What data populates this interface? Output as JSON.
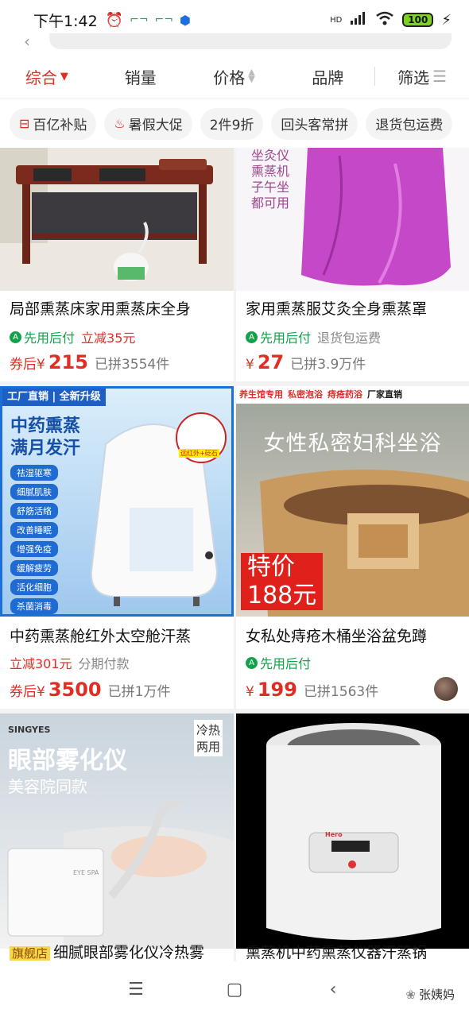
{
  "status": {
    "time": "下午1:42",
    "battery": "100",
    "hd": "HD"
  },
  "sort": {
    "items": [
      "综合",
      "销量",
      "价格",
      "品牌",
      "筛选"
    ]
  },
  "chips": [
    {
      "label": "百亿补贴"
    },
    {
      "label": "暑假大促"
    },
    {
      "label": "2件9折"
    },
    {
      "label": "回头客常拼"
    },
    {
      "label": "退货包运费"
    }
  ],
  "products": [
    {
      "title": "局部熏蒸床家用熏蒸床全身",
      "tag1": "先用后付",
      "tag2": "立减35元",
      "price_prefix": "券后¥",
      "price": "215",
      "sold": "已拼3554件",
      "image_text": []
    },
    {
      "title": "家用熏蒸服艾灸全身熏蒸罩",
      "tag1": "先用后付",
      "tag2": "退货包运费",
      "price_prefix": "¥",
      "price": "27",
      "sold": "已拼3.9万件",
      "image_text": [
        "坐灸仪",
        "熏蒸机",
        "子午坐",
        "都可用"
      ]
    },
    {
      "title": "中药熏蒸舱红外太空舱汗蒸",
      "tag1": "立减301元",
      "tag2": "分期付款",
      "price_prefix": "券后¥",
      "price": "3500",
      "sold": "已拼1万件",
      "image_text": [
        "工厂直销 | 全新升级",
        "中药熏蒸",
        "满月发汗",
        "祛湿驱寒",
        "细腻肌肤",
        "舒筋活络",
        "改善睡眠",
        "增强免疫",
        "缓解疲劳",
        "活化细胞",
        "杀菌消毒",
        "远红外+砭石"
      ]
    },
    {
      "title": "女私处痔疮木桶坐浴盆免蹲",
      "tag1": "先用后付",
      "tag2": "",
      "price_prefix": "¥",
      "price": "199",
      "sold": "已拼1563件",
      "image_text": [
        "养生馆专用",
        "私密泡浴",
        "痔疮药浴",
        "厂家直销",
        "女性私密妇科坐浴",
        "特价",
        "188元"
      ]
    },
    {
      "title": "细腻眼部雾化仪冷热雾",
      "badge": "旗舰店",
      "image_text": [
        "SINGYES",
        "眼部雾化仪",
        "美容院同款",
        "冷热两用",
        "EYE SPA"
      ]
    },
    {
      "title": "熏蒸机中药熏蒸仪器汗蒸锅",
      "image_text": [
        "Hero"
      ]
    }
  ],
  "watermark": "张姨妈",
  "colors": {
    "accent": "#e02e24",
    "green": "#12a34a"
  }
}
